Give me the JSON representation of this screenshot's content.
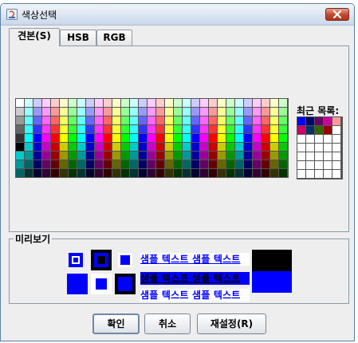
{
  "window": {
    "title": "색상선택"
  },
  "tabs": [
    {
      "label": "견본(S)",
      "selected": true
    },
    {
      "label": "HSB",
      "selected": false
    },
    {
      "label": "RGB",
      "selected": false
    }
  ],
  "swatches": {
    "rows": 9,
    "cols": 31,
    "colors": [
      [
        "#ffffff",
        "#ccffff",
        "#ccccff",
        "#ffccff",
        "#ffcccc",
        "#ffffcc",
        "#ccffcc",
        "#ccffff",
        "#ccccff",
        "#ffccff",
        "#ffcccc",
        "#ffffcc",
        "#ccffcc",
        "#ccffff",
        "#ccccff",
        "#ffccff",
        "#ffcccc",
        "#ffffcc",
        "#ccffcc",
        "#ccffff",
        "#ccccff",
        "#ffccff",
        "#ffcccc",
        "#ffffcc",
        "#ccffcc",
        "#ccffff",
        "#ccccff",
        "#ffccff",
        "#ffcccc",
        "#ffffcc",
        "#ccffcc"
      ],
      [
        "#cccccc",
        "#99ffff",
        "#9999ff",
        "#ff99ff",
        "#ff9999",
        "#ffff99",
        "#99ff99",
        "#99ffff",
        "#9999ff",
        "#ff99ff",
        "#ff9999",
        "#ffff99",
        "#99ff99",
        "#99ffff",
        "#9999ff",
        "#ff99ff",
        "#ff9999",
        "#ffff99",
        "#99ff99",
        "#99ffff",
        "#9999ff",
        "#ff99ff",
        "#ff9999",
        "#ffff99",
        "#99ff99",
        "#99ffff",
        "#9999ff",
        "#ff99ff",
        "#ff9999",
        "#ffff99",
        "#99ff99"
      ],
      [
        "#999999",
        "#66ffff",
        "#6666ff",
        "#ff66ff",
        "#ff6666",
        "#ffff66",
        "#66ff66",
        "#66ffff",
        "#6666ff",
        "#ff66ff",
        "#ff6666",
        "#ffff66",
        "#66ff66",
        "#66ffff",
        "#6666ff",
        "#ff66ff",
        "#ff6666",
        "#ffff66",
        "#66ff66",
        "#66ffff",
        "#6666ff",
        "#ff66ff",
        "#ff6666",
        "#ffff66",
        "#66ff66",
        "#66ffff",
        "#6666ff",
        "#ff66ff",
        "#ff6666",
        "#ffff66",
        "#66ff66"
      ],
      [
        "#666666",
        "#33ffff",
        "#3333ff",
        "#ff33ff",
        "#ff3333",
        "#ffff33",
        "#33ff33",
        "#33ffff",
        "#3333ff",
        "#ff33ff",
        "#ff3333",
        "#ffff33",
        "#33ff33",
        "#33ffff",
        "#3333ff",
        "#ff33ff",
        "#ff3333",
        "#ffff33",
        "#33ff33",
        "#33ffff",
        "#3333ff",
        "#ff33ff",
        "#ff3333",
        "#ffff33",
        "#33ff33",
        "#33ffff",
        "#3333ff",
        "#ff33ff",
        "#ff3333",
        "#ffff33",
        "#33ff33"
      ],
      [
        "#333333",
        "#00ffff",
        "#0000ff",
        "#ff00ff",
        "#ff0000",
        "#ffff00",
        "#00ff00",
        "#00ffff",
        "#0000ff",
        "#ff00ff",
        "#ff0000",
        "#ffff00",
        "#00ff00",
        "#00ffff",
        "#0000ff",
        "#ff00ff",
        "#ff0000",
        "#ffff00",
        "#00ff00",
        "#00ffff",
        "#0000ff",
        "#ff00ff",
        "#ff0000",
        "#ffff00",
        "#00ff00",
        "#00ffff",
        "#0000ff",
        "#ff00ff",
        "#ff0000",
        "#ffff00",
        "#00ff00"
      ],
      [
        "#000000",
        "#00cccc",
        "#0000cc",
        "#cc00cc",
        "#cc0000",
        "#cccc00",
        "#00cc00",
        "#00cccc",
        "#0000cc",
        "#cc00cc",
        "#cc0000",
        "#cccc00",
        "#00cc00",
        "#00cccc",
        "#0000cc",
        "#cc00cc",
        "#cc0000",
        "#cccc00",
        "#00cc00",
        "#00cccc",
        "#0000cc",
        "#cc00cc",
        "#cc0000",
        "#cccc00",
        "#00cc00",
        "#00cccc",
        "#0000cc",
        "#cc00cc",
        "#cc0000",
        "#cccc00",
        "#00cc00"
      ],
      [
        "#00cccc",
        "#009999",
        "#000099",
        "#990099",
        "#990000",
        "#999900",
        "#009900",
        "#009999",
        "#000099",
        "#990099",
        "#990000",
        "#999900",
        "#009900",
        "#009999",
        "#000099",
        "#990099",
        "#990000",
        "#999900",
        "#009900",
        "#009999",
        "#000099",
        "#990099",
        "#990000",
        "#999900",
        "#009900",
        "#009999",
        "#000099",
        "#990099",
        "#990000",
        "#999900",
        "#009900"
      ],
      [
        "#009999",
        "#006666",
        "#000066",
        "#660066",
        "#660000",
        "#666600",
        "#006600",
        "#006666",
        "#000066",
        "#660066",
        "#660000",
        "#666600",
        "#006600",
        "#006666",
        "#000066",
        "#660066",
        "#660000",
        "#666600",
        "#006600",
        "#006666",
        "#000066",
        "#660066",
        "#660000",
        "#666600",
        "#006600",
        "#006666",
        "#000066",
        "#660066",
        "#660000",
        "#666600",
        "#006600"
      ],
      [
        "#006666",
        "#003333",
        "#000033",
        "#330033",
        "#330000",
        "#333300",
        "#003300",
        "#003333",
        "#000033",
        "#330033",
        "#330000",
        "#333300",
        "#003300",
        "#003333",
        "#000033",
        "#330033",
        "#330000",
        "#333300",
        "#003300",
        "#003333",
        "#000033",
        "#330033",
        "#330000",
        "#333300",
        "#003300",
        "#003333",
        "#000033",
        "#330033",
        "#330000",
        "#333300",
        "#003300"
      ]
    ]
  },
  "recent": {
    "label": "최근 목록:",
    "rows": 7,
    "cols": 5,
    "colors": [
      [
        "#0000ff",
        "#000066",
        "#660066",
        "#cc0099",
        "#ff9999"
      ],
      [
        "#cc0066",
        "#003366",
        "#336600",
        "#990000",
        "#ffffff"
      ],
      [
        "#ffffff",
        "#ffffff",
        "#ffffff",
        "#ffffff",
        "#ffffff"
      ],
      [
        "#ffffff",
        "#ffffff",
        "#ffffff",
        "#ffffff",
        "#ffffff"
      ],
      [
        "#ffffff",
        "#ffffff",
        "#ffffff",
        "#ffffff",
        "#ffffff"
      ],
      [
        "#ffffff",
        "#ffffff",
        "#ffffff",
        "#ffffff",
        "#ffffff"
      ],
      [
        "#ffffff",
        "#ffffff",
        "#ffffff",
        "#ffffff",
        "#ffffff"
      ]
    ]
  },
  "preview": {
    "title": "미리보기",
    "selected_color": "#0000ff",
    "sample_text": "샘플 텍스트  샘플 텍스트"
  },
  "buttons": {
    "ok": "확인",
    "cancel": "취소",
    "reset": "재설정(R)"
  }
}
